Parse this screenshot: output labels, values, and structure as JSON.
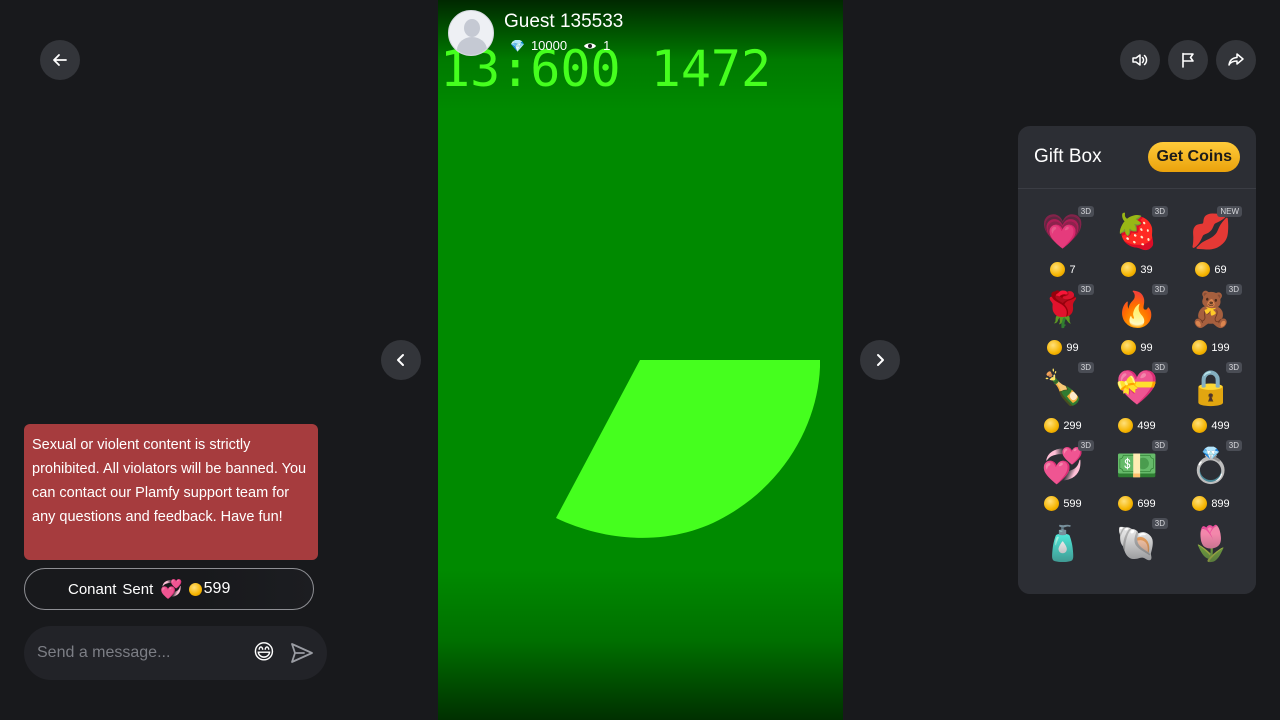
{
  "host": {
    "name": "Guest 135533",
    "diamonds": "10000",
    "viewers": "1"
  },
  "video": {
    "overlay_text": "13:600 1472"
  },
  "notice": "Sexual or violent content is strictly prohibited. All violators will be banned. You can contact our Plamfy support team for any questions and feedback. Have fun!",
  "gift_message": {
    "sender": "Conant",
    "action": "Sent",
    "amount": "599"
  },
  "composer": {
    "placeholder": "Send a message..."
  },
  "gift_box": {
    "title": "Gift Box",
    "get_coins_label": "Get Coins",
    "gifts": [
      {
        "icon": "follow-me-heart-icon",
        "badge": "3D",
        "price": "7"
      },
      {
        "icon": "strawberry-icon",
        "badge": "3D",
        "price": "39"
      },
      {
        "icon": "lips-icon",
        "badge": "NEW",
        "price": "69"
      },
      {
        "icon": "rose-icon",
        "badge": "3D",
        "price": "99"
      },
      {
        "icon": "fire-icon",
        "badge": "3D",
        "price": "99"
      },
      {
        "icon": "teddy-bear-icon",
        "badge": "3D",
        "price": "199"
      },
      {
        "icon": "champagne-icon",
        "badge": "3D",
        "price": "299"
      },
      {
        "icon": "chocolate-box-icon",
        "badge": "3D",
        "price": "499"
      },
      {
        "icon": "heart-lock-icon",
        "badge": "3D",
        "price": "499"
      },
      {
        "icon": "hearts-icon",
        "badge": "3D",
        "price": "599"
      },
      {
        "icon": "money-stack-icon",
        "badge": "3D",
        "price": "699"
      },
      {
        "icon": "ring-icon",
        "badge": "3D",
        "price": "899"
      },
      {
        "icon": "perfume-icon",
        "badge": "",
        "price": ""
      },
      {
        "icon": "shell-icon",
        "badge": "3D",
        "price": ""
      },
      {
        "icon": "tulips-icon",
        "badge": "",
        "price": ""
      }
    ]
  },
  "colors": {
    "background": "#18191c",
    "notice_bg": "#a63c3e",
    "video_green": "#008a00",
    "shape_green": "#45ff1e",
    "coin_gold": "#f5b400"
  }
}
